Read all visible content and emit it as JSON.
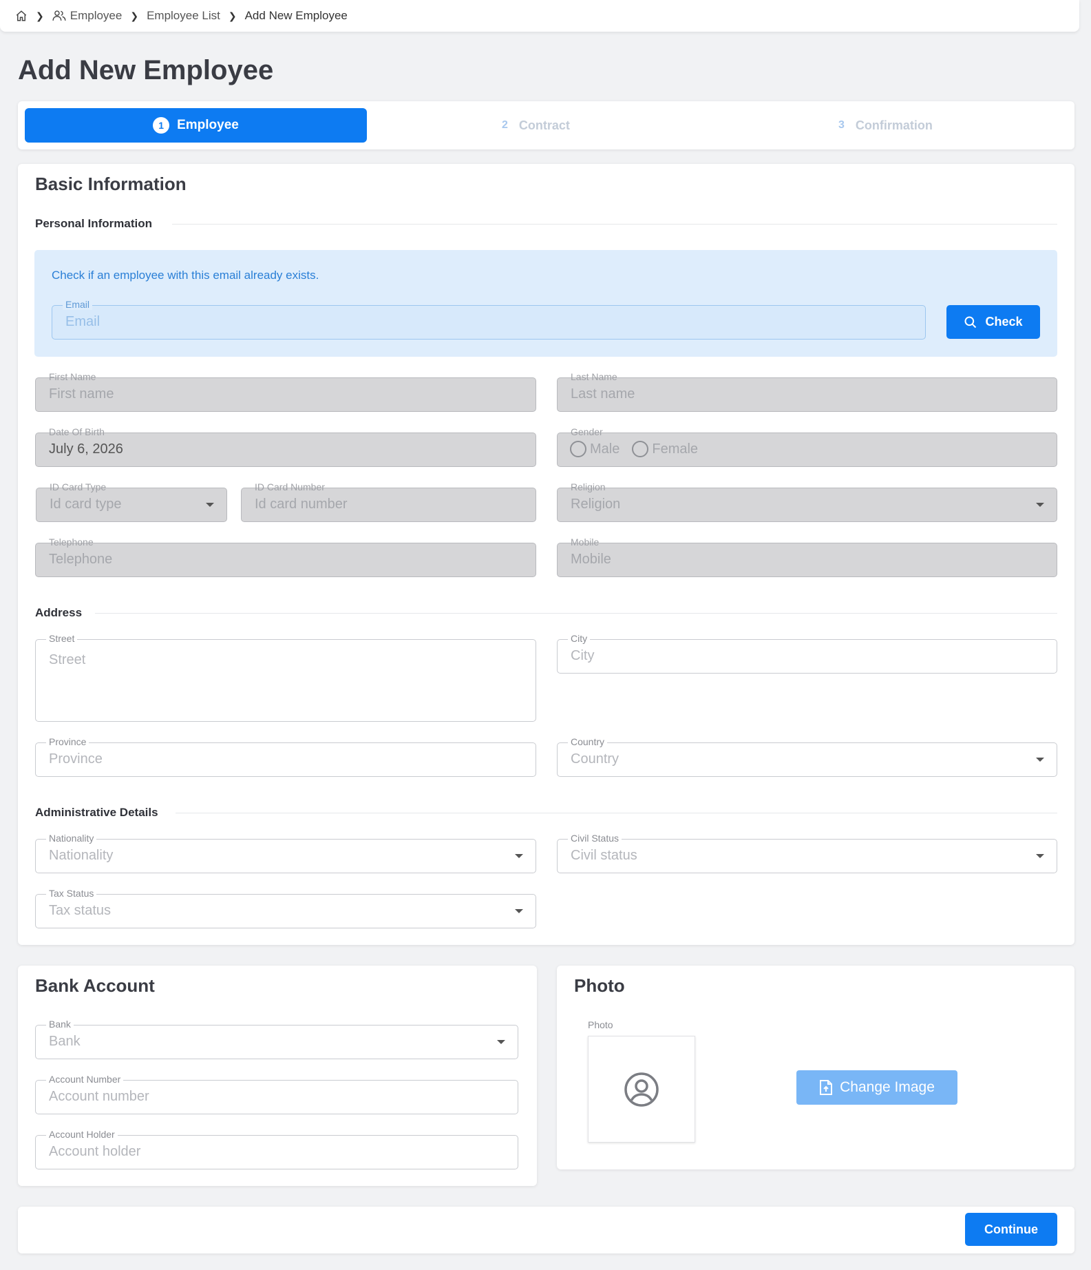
{
  "breadcrumb": {
    "items": [
      "Employee",
      "Employee List",
      "Add New Employee"
    ]
  },
  "page_title": "Add New Employee",
  "stepper": {
    "steps": [
      {
        "num": "1",
        "label": "Employee"
      },
      {
        "num": "2",
        "label": "Contract"
      },
      {
        "num": "3",
        "label": "Confirmation"
      }
    ]
  },
  "basic": {
    "title": "Basic Information",
    "personal_heading": "Personal Information",
    "email_check": {
      "message": "Check if an employee with this email already exists.",
      "label": "Email",
      "placeholder": "Email",
      "button": "Check"
    },
    "first_name": {
      "label": "First Name",
      "placeholder": "First name"
    },
    "last_name": {
      "label": "Last Name",
      "placeholder": "Last name"
    },
    "dob": {
      "label": "Date Of Birth",
      "value": "July 6, 2026"
    },
    "gender": {
      "label": "Gender",
      "options": [
        "Male",
        "Female"
      ]
    },
    "id_card_type": {
      "label": "ID Card Type",
      "placeholder": "Id card type"
    },
    "id_card_number": {
      "label": "ID Card Number",
      "placeholder": "Id card number"
    },
    "religion": {
      "label": "Religion",
      "placeholder": "Religion"
    },
    "telephone": {
      "label": "Telephone",
      "placeholder": "Telephone"
    },
    "mobile": {
      "label": "Mobile",
      "placeholder": "Mobile"
    },
    "address_heading": "Address",
    "street": {
      "label": "Street",
      "placeholder": "Street"
    },
    "city": {
      "label": "City",
      "placeholder": "City"
    },
    "province": {
      "label": "Province",
      "placeholder": "Province"
    },
    "country": {
      "label": "Country",
      "placeholder": "Country"
    },
    "admin_heading": "Administrative Details",
    "nationality": {
      "label": "Nationality",
      "placeholder": "Nationality"
    },
    "civil_status": {
      "label": "Civil Status",
      "placeholder": "Civil status"
    },
    "tax_status": {
      "label": "Tax Status",
      "placeholder": "Tax status"
    }
  },
  "bank": {
    "title": "Bank Account",
    "bank": {
      "label": "Bank",
      "placeholder": "Bank"
    },
    "account_number": {
      "label": "Account Number",
      "placeholder": "Account number"
    },
    "account_holder": {
      "label": "Account Holder",
      "placeholder": "Account holder"
    }
  },
  "photo": {
    "title": "Photo",
    "label": "Photo",
    "button": "Change Image"
  },
  "footer": {
    "continue": "Continue"
  },
  "colors": {
    "primary": "#0d7bf2",
    "info_bg": "#deedfc",
    "disabled_bg": "#d6d6d8"
  },
  "icons": [
    "home-icon",
    "users-icon",
    "chevron-right-icon",
    "search-icon",
    "user-circle-icon",
    "file-upload-icon",
    "caret-down-icon"
  ]
}
